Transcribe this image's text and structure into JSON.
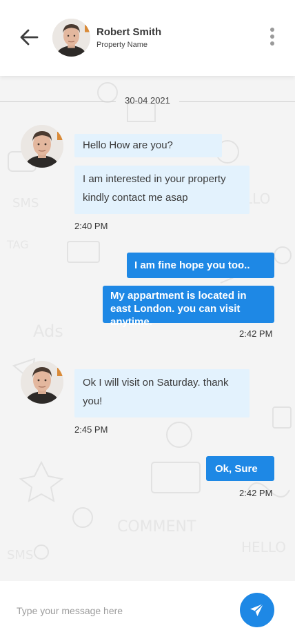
{
  "header": {
    "back_icon": "arrow-left-icon",
    "contact_name": "Robert Smith",
    "contact_subtitle": "Property Name",
    "menu_icon": "more-vertical-icon"
  },
  "chat": {
    "date": "30-04 2021",
    "messages": [
      {
        "direction": "incoming",
        "text": "Hello How are you?"
      },
      {
        "direction": "incoming",
        "text": "I am interested in your property kindly contact me asap"
      },
      {
        "direction": "time",
        "text": "2:40 PM"
      },
      {
        "direction": "outgoing",
        "text": "I am fine hope you too.."
      },
      {
        "direction": "outgoing",
        "text": "My appartment is located in east London. you can visit anytime."
      },
      {
        "direction": "time",
        "text": "2:42 PM"
      },
      {
        "direction": "incoming",
        "text": "Ok I will visit on Saturday. thank you!"
      },
      {
        "direction": "time",
        "text": "2:45 PM"
      },
      {
        "direction": "outgoing",
        "text": "Ok, Sure"
      },
      {
        "direction": "time",
        "text": "2:42 PM"
      }
    ]
  },
  "composer": {
    "placeholder": "Type your message here",
    "value": "",
    "send_icon": "send-icon"
  },
  "colors": {
    "accent": "#1e88e5",
    "incoming_bubble": "#e3f2fd",
    "background": "#f4f4f4"
  }
}
